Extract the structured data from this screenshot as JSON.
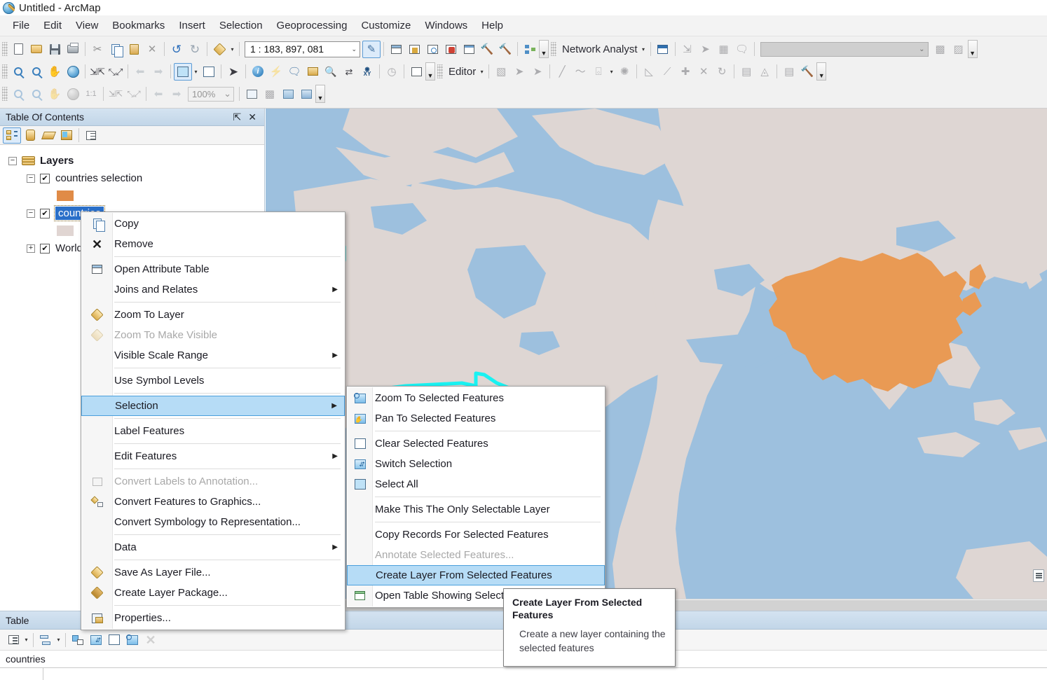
{
  "window": {
    "title": "Untitled - ArcMap",
    "icon": "arcmap-globe-icon"
  },
  "menubar": {
    "items": [
      "File",
      "Edit",
      "View",
      "Bookmarks",
      "Insert",
      "Selection",
      "Geoprocessing",
      "Customize",
      "Windows",
      "Help"
    ]
  },
  "toolbars": {
    "scale_value": "1 : 183, 897, 081",
    "zoom_percent": "100%",
    "network_analyst_label": "Network Analyst",
    "editor_label": "Editor",
    "network_combo_value": ""
  },
  "toc": {
    "title": "Table Of Contents",
    "pin_glyph": "⇱",
    "close_glyph": "✕",
    "tools": [
      "list-by-drawing-order-icon",
      "list-by-source-icon",
      "list-by-visibility-icon",
      "list-by-selection-icon",
      "options-icon"
    ],
    "tree": {
      "root": "Layers",
      "items": [
        {
          "label": "countries selection",
          "checked": true,
          "swatch": "#e08b47"
        },
        {
          "label": "countries",
          "checked": true,
          "swatch": "#e0d5d2",
          "selected": true
        },
        {
          "label": "World",
          "checked": true,
          "swatch": ""
        }
      ]
    }
  },
  "map": {
    "ocean_color": "#9dc0de",
    "land_color": "#ded6d3",
    "highlight_color": "#e99a54",
    "selection_outline_color": "#19f2f2"
  },
  "context_menu": {
    "items": [
      {
        "label": "Copy",
        "icon": "copy-icon",
        "disabled": false,
        "submenu": false
      },
      {
        "label": "Remove",
        "icon": "remove-x-icon",
        "disabled": false,
        "submenu": false
      },
      {
        "sep": true
      },
      {
        "label": "Open Attribute Table",
        "icon": "attribute-table-icon",
        "disabled": false,
        "submenu": false
      },
      {
        "label": "Joins and Relates",
        "icon": "",
        "disabled": false,
        "submenu": true
      },
      {
        "sep": true
      },
      {
        "label": "Zoom To Layer",
        "icon": "zoom-to-layer-icon",
        "disabled": false,
        "submenu": false
      },
      {
        "label": "Zoom To Make Visible",
        "icon": "zoom-make-visible-icon",
        "disabled": true,
        "submenu": false
      },
      {
        "label": "Visible Scale Range",
        "icon": "",
        "disabled": false,
        "submenu": true
      },
      {
        "sep": true
      },
      {
        "label": "Use Symbol Levels",
        "icon": "",
        "disabled": false,
        "submenu": false
      },
      {
        "sep": true
      },
      {
        "label": "Selection",
        "icon": "",
        "disabled": false,
        "submenu": true,
        "highlighted": true
      },
      {
        "sep": true
      },
      {
        "label": "Label Features",
        "icon": "",
        "disabled": false,
        "submenu": false
      },
      {
        "sep": true
      },
      {
        "label": "Edit Features",
        "icon": "",
        "disabled": false,
        "submenu": true
      },
      {
        "sep": true
      },
      {
        "label": "Convert Labels to Annotation...",
        "icon": "convert-labels-icon",
        "disabled": true,
        "submenu": false
      },
      {
        "label": "Convert Features to Graphics...",
        "icon": "convert-graphics-icon",
        "disabled": false,
        "submenu": false
      },
      {
        "label": "Convert Symbology to Representation...",
        "icon": "",
        "disabled": false,
        "submenu": false
      },
      {
        "sep": true
      },
      {
        "label": "Data",
        "icon": "",
        "disabled": false,
        "submenu": true
      },
      {
        "sep": true
      },
      {
        "label": "Save As Layer File...",
        "icon": "layer-file-icon",
        "disabled": false,
        "submenu": false
      },
      {
        "label": "Create Layer Package...",
        "icon": "layer-package-icon",
        "disabled": false,
        "submenu": false
      },
      {
        "sep": true
      },
      {
        "label": "Properties...",
        "icon": "properties-icon",
        "disabled": false,
        "submenu": false
      }
    ]
  },
  "submenu": {
    "items": [
      {
        "label": "Zoom To Selected Features",
        "icon": "zoom-selected-icon",
        "disabled": false
      },
      {
        "label": "Pan To Selected Features",
        "icon": "pan-selected-icon",
        "disabled": false
      },
      {
        "sep": true
      },
      {
        "label": "Clear Selected Features",
        "icon": "clear-selection-icon",
        "disabled": false
      },
      {
        "label": "Switch Selection",
        "icon": "switch-selection-icon",
        "disabled": false
      },
      {
        "label": "Select All",
        "icon": "select-all-icon",
        "disabled": false
      },
      {
        "sep": true
      },
      {
        "label": "Make This The Only Selectable Layer",
        "icon": "",
        "disabled": false
      },
      {
        "sep": true
      },
      {
        "label": "Copy Records For Selected Features",
        "icon": "",
        "disabled": false
      },
      {
        "label": "Annotate Selected Features...",
        "icon": "",
        "disabled": true
      },
      {
        "label": "Create Layer From Selected Features",
        "icon": "",
        "disabled": false,
        "highlighted": true
      },
      {
        "label": "Open Table Showing Selected Features",
        "icon": "table-icon",
        "disabled": false
      }
    ]
  },
  "tooltip": {
    "title": "Create Layer From Selected Features",
    "body": "Create a new layer containing the selected features"
  },
  "table_panel": {
    "title": "Table",
    "tab_label": "countries",
    "tools": [
      "table-options-icon",
      "related-tables-icon",
      "select-by-attributes-icon",
      "switch-selection-icon",
      "clear-selection-icon",
      "zoom-to-selected-icon",
      "delete-icon"
    ]
  }
}
